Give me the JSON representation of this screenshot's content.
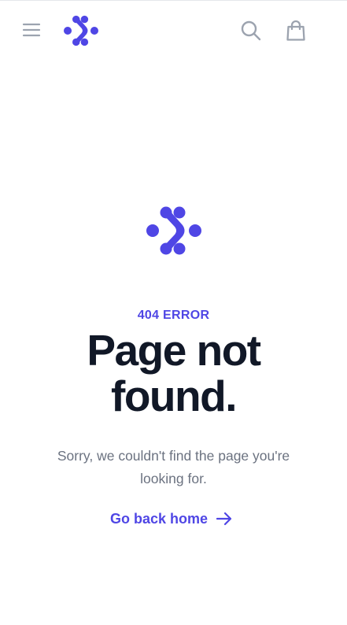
{
  "header": {
    "menu_icon": "menu-icon",
    "logo_icon": "brand-logo-icon",
    "search_icon": "search-icon",
    "cart_icon": "shopping-bag-icon"
  },
  "main": {
    "logo_icon": "brand-logo-icon",
    "error_code": "404 ERROR",
    "title": "Page not found.",
    "message": "Sorry, we couldn't find the page you're looking for.",
    "home_link_label": "Go back home",
    "home_link_icon": "arrow-right-icon"
  },
  "colors": {
    "brand": "#4f46e5",
    "heading": "#111827",
    "body_text": "#6b7280",
    "icon_gray": "#9ca3af",
    "background": "#ffffff"
  }
}
